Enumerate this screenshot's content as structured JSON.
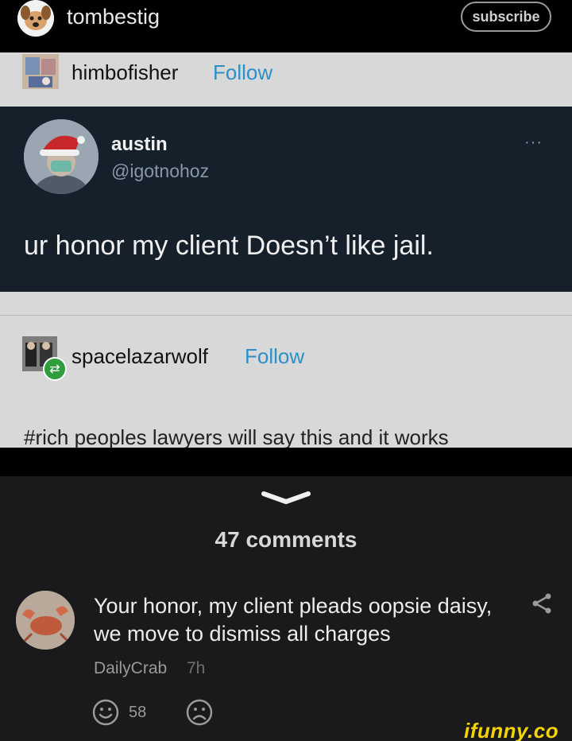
{
  "header": {
    "username": "tombestig",
    "subscribe_label": "subscribe"
  },
  "tumblr_post": {
    "author": "himbofisher",
    "follow_label": "Follow"
  },
  "tweet": {
    "display_name": "austin",
    "handle": "@igotnohoz",
    "more_label": "···",
    "text": "ur honor my client Doesn’t like jail."
  },
  "reblog": {
    "author": "spacelazarwolf",
    "follow_label": "Follow",
    "tag_text": "#rich peoples lawyers will say this and it works"
  },
  "comments": {
    "count_label": "47 comments",
    "items": [
      {
        "text": "Your honor, my client pleads oopsie daisy, we move to dismiss all charges",
        "author": "DailyCrab",
        "time": "7h",
        "likes": "58"
      }
    ]
  },
  "watermark": "ifunny.co"
}
